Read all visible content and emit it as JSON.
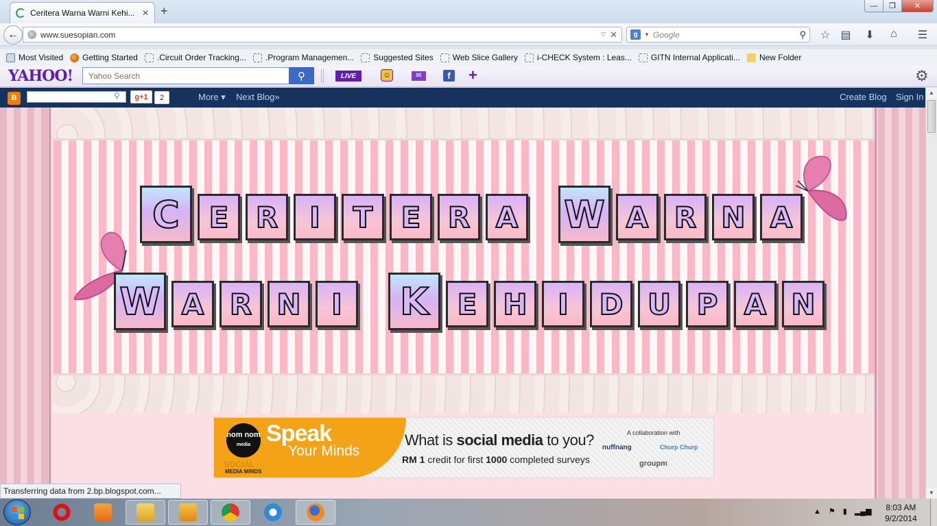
{
  "browser": {
    "tab_title": "Ceritera Warna Warni Kehi...",
    "url": "www.suesopian.com",
    "search_placeholder": "Google"
  },
  "bookmarks": [
    "Most Visited",
    "Getting Started",
    ".Circuit Order Tracking...",
    ".Program Managemen...",
    "Suggested Sites",
    "Web Slice Gallery",
    "i-CHECK System : Leas...",
    "GITN Internal Applicati...",
    "New Folder"
  ],
  "yahoo": {
    "logo": "YAHOO!",
    "search_placeholder": "Yahoo Search",
    "live_label": "LIVE"
  },
  "blogger": {
    "gplus_label": "g+1",
    "gplus_count": "2",
    "more_label": "More ▾",
    "next_blog_label": "Next Blog»",
    "create_blog_label": "Create Blog",
    "sign_in_label": "Sign In"
  },
  "blog_header": {
    "line1": [
      "C",
      "E",
      "R",
      "I",
      "T",
      "E",
      "R",
      "A",
      " ",
      "W",
      "A",
      "R",
      "N",
      "A"
    ],
    "line2": [
      "W",
      "A",
      "R",
      "N",
      "I",
      " ",
      "K",
      "E",
      "H",
      "I",
      "D",
      "U",
      "P",
      "A",
      "N"
    ]
  },
  "ad": {
    "logo_text": "nom nom",
    "logo_sub": "media",
    "social": "SOCIAL",
    "social_sub": "MEDIA MINDS",
    "speak": "Speak",
    "your_minds": "Your Minds",
    "question_pre": "What is ",
    "question_bold": "social media",
    "question_post": " to you?",
    "credit_a": "RM 1",
    "credit_b": " credit for first ",
    "credit_c": "1000",
    "credit_d": " completed surveys",
    "collab": "A collaboration with",
    "nuffnang": "nuffnang",
    "churp": "Churp Churp",
    "groupm": "groupm"
  },
  "status_text": "Transferring data from 2.bp.blogspot.com...",
  "taskbar": {
    "time": "8:03 AM",
    "date": "9/2/2014"
  },
  "colors": {
    "yahoo_purple": "#5e1fb0",
    "blogger_navy": "#16335e",
    "blog_pink": "#f9b8c6"
  }
}
